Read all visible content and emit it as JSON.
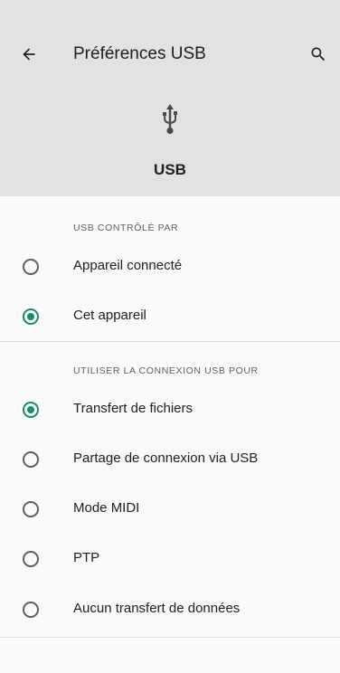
{
  "header": {
    "title": "Préférences USB",
    "usb_label": "USB",
    "back_icon": "arrow-back-icon",
    "search_icon": "search-icon"
  },
  "sections": [
    {
      "header": "USB CONTRÔLÉ PAR",
      "options": [
        {
          "label": "Appareil connecté",
          "checked": false
        },
        {
          "label": "Cet appareil",
          "checked": true
        }
      ]
    },
    {
      "header": "UTILISER LA CONNEXION USB POUR",
      "options": [
        {
          "label": "Transfert de fichiers",
          "checked": true
        },
        {
          "label": "Partage de connexion via USB",
          "checked": false
        },
        {
          "label": "Mode MIDI",
          "checked": false
        },
        {
          "label": "PTP",
          "checked": false
        },
        {
          "label": "Aucun transfert de données",
          "checked": false
        }
      ]
    }
  ],
  "colors": {
    "accent": "#1b8a6b",
    "header_bg": "#e2e2e2",
    "page_bg": "#fafafa"
  }
}
